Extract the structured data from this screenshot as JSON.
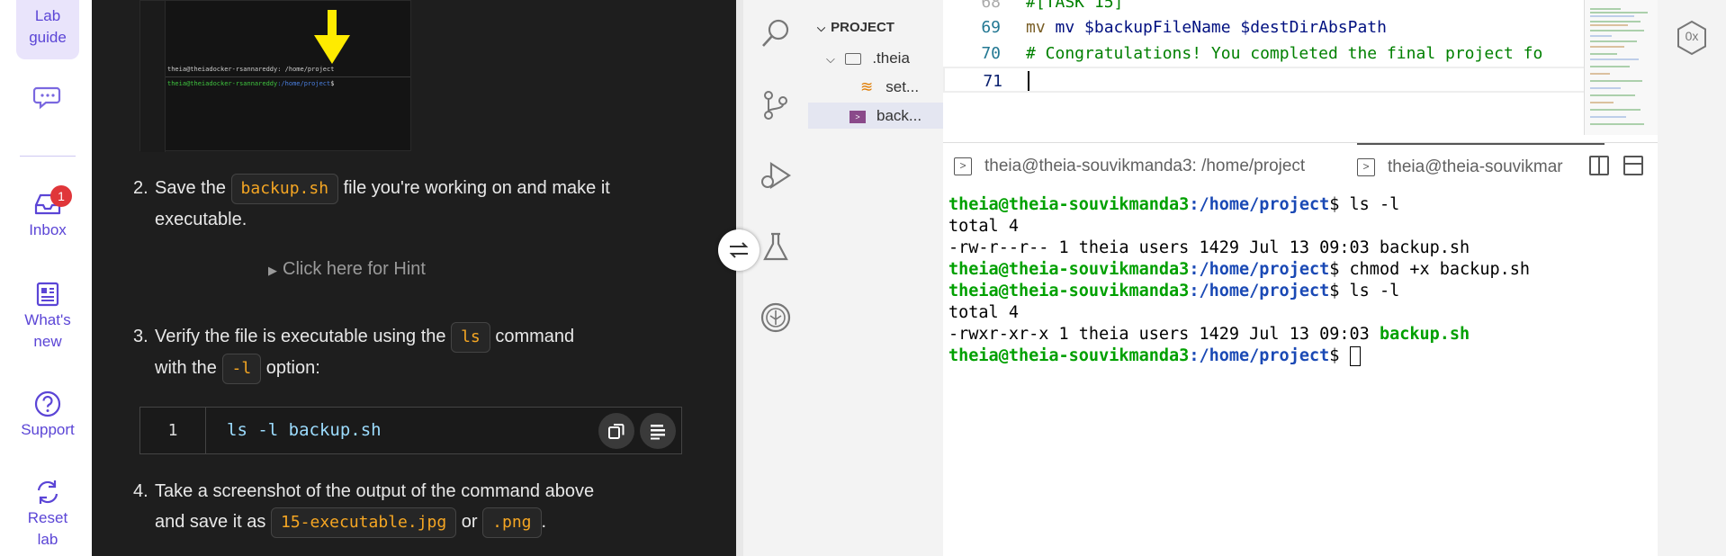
{
  "nav": {
    "lab_guide": "Lab guide",
    "inbox": "Inbox",
    "inbox_badge": "1",
    "whats_new": "What's new",
    "support": "Support",
    "reset_lab": "Reset lab"
  },
  "guide": {
    "screenshot": {
      "tab_title": "theia@theiadocker-rsannareddy: /home/project",
      "prompt_user": "theia@theiadocker-rsannareddy",
      "prompt_path": ":/home/project",
      "prompt_symbol": "$"
    },
    "step2": {
      "num": "2.",
      "before": "Save the",
      "code": "backup.sh",
      "after": "file you're working on and make it executable."
    },
    "hint": "Click here for Hint",
    "step3": {
      "num": "3.",
      "before": "Verify the file is executable using the",
      "code1": "ls",
      "middle1": "command",
      "middle2": "with the",
      "code2": "-l",
      "after": "option:"
    },
    "codeblock": {
      "line_number": "1",
      "code": "ls -l backup.sh"
    },
    "step4": {
      "num": "4.",
      "line1": "Take a screenshot of the output of the command above",
      "line2_before": "and save it as",
      "code1": "15-executable.jpg",
      "or": "or",
      "code2": ".png",
      "end": "."
    }
  },
  "ide": {
    "explorer": {
      "section": "PROJECT",
      "folder": ".theia",
      "file1": "set...",
      "file2": "back..."
    },
    "editor": {
      "lines": [
        {
          "num": "69",
          "text": "mv $backupFileName $destDirAbsPath"
        },
        {
          "num": "70",
          "text": "# Congratulations! You completed the final project fo"
        },
        {
          "num": "71",
          "text": ""
        }
      ]
    },
    "terminal": {
      "tab1": "theia@theia-souvikmanda3: /home/project",
      "tab2": "theia@theia-souvikmar",
      "user": "theia@theia-souvikmanda3",
      "path": ":/home/project",
      "dollar": "$",
      "cmd1": " ls -l",
      "out1": "total 4",
      "out2": "-rw-r--r-- 1 theia users 1429 Jul 13 09:03 backup.sh",
      "cmd2": " chmod +x backup.sh",
      "cmd3": " ls -l",
      "out3": "total 4",
      "out4_prefix": "-rwxr-xr-x 1 theia users 1429 Jul 13 09:03 ",
      "out4_file": "backup.sh",
      "cmd4": " "
    },
    "right_icon_label": "0x"
  }
}
